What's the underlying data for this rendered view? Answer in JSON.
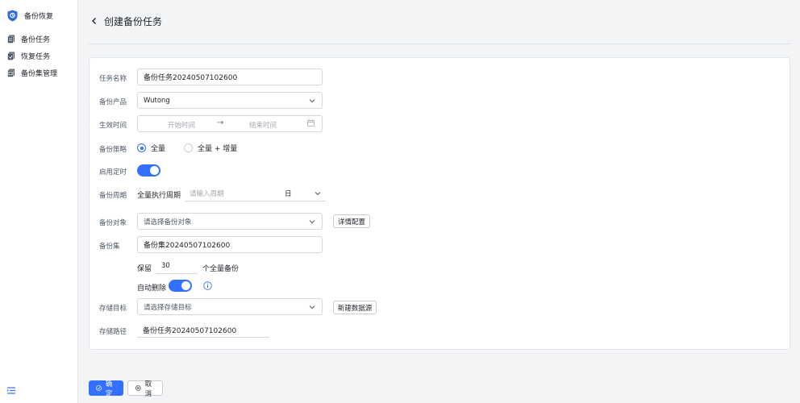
{
  "app": {
    "title": "备份恢复"
  },
  "sidebar": {
    "items": [
      {
        "label": "备份任务"
      },
      {
        "label": "恢复任务"
      },
      {
        "label": "备份集管理"
      }
    ]
  },
  "header": {
    "title": "创建备份任务"
  },
  "form": {
    "task_name": {
      "label": "任务名称",
      "value": "备份任务20240507102600"
    },
    "product": {
      "label": "备份产品",
      "value": "Wutong"
    },
    "effective_time": {
      "label": "生效时间",
      "start_placeholder": "开始时间",
      "end_placeholder": "结束时间",
      "separator": "→"
    },
    "strategy": {
      "label": "备份策略",
      "options": [
        {
          "label": "全量",
          "selected": true
        },
        {
          "label": "全量 + 增量",
          "selected": false
        }
      ]
    },
    "timer": {
      "label": "启用定时",
      "enabled": true
    },
    "period": {
      "label": "备份周期",
      "prefix": "全量执行周期",
      "placeholder": "请输入周期",
      "unit": "日"
    },
    "target": {
      "label": "备份对象",
      "placeholder": "请选择备份对象",
      "detail_button": "详情配置"
    },
    "backup_set": {
      "label": "备份集",
      "value": "备份集20240507102600"
    },
    "retention": {
      "prefix": "保留",
      "value": "30",
      "suffix": "个全量备份"
    },
    "auto_delete": {
      "label": "自动删除",
      "enabled": true
    },
    "storage": {
      "label": "存储目标",
      "placeholder": "请选择存储目标",
      "new_button": "新建数据源"
    },
    "path": {
      "label": "存储路径",
      "value": "备份任务20240507102600"
    }
  },
  "footer": {
    "confirm": "确定",
    "cancel": "取消"
  },
  "colors": {
    "primary": "#3370ff",
    "sidebar_bg": "#ffffff",
    "page_bg": "#f3f4f6",
    "brand_icon": "#2f6bd9"
  }
}
